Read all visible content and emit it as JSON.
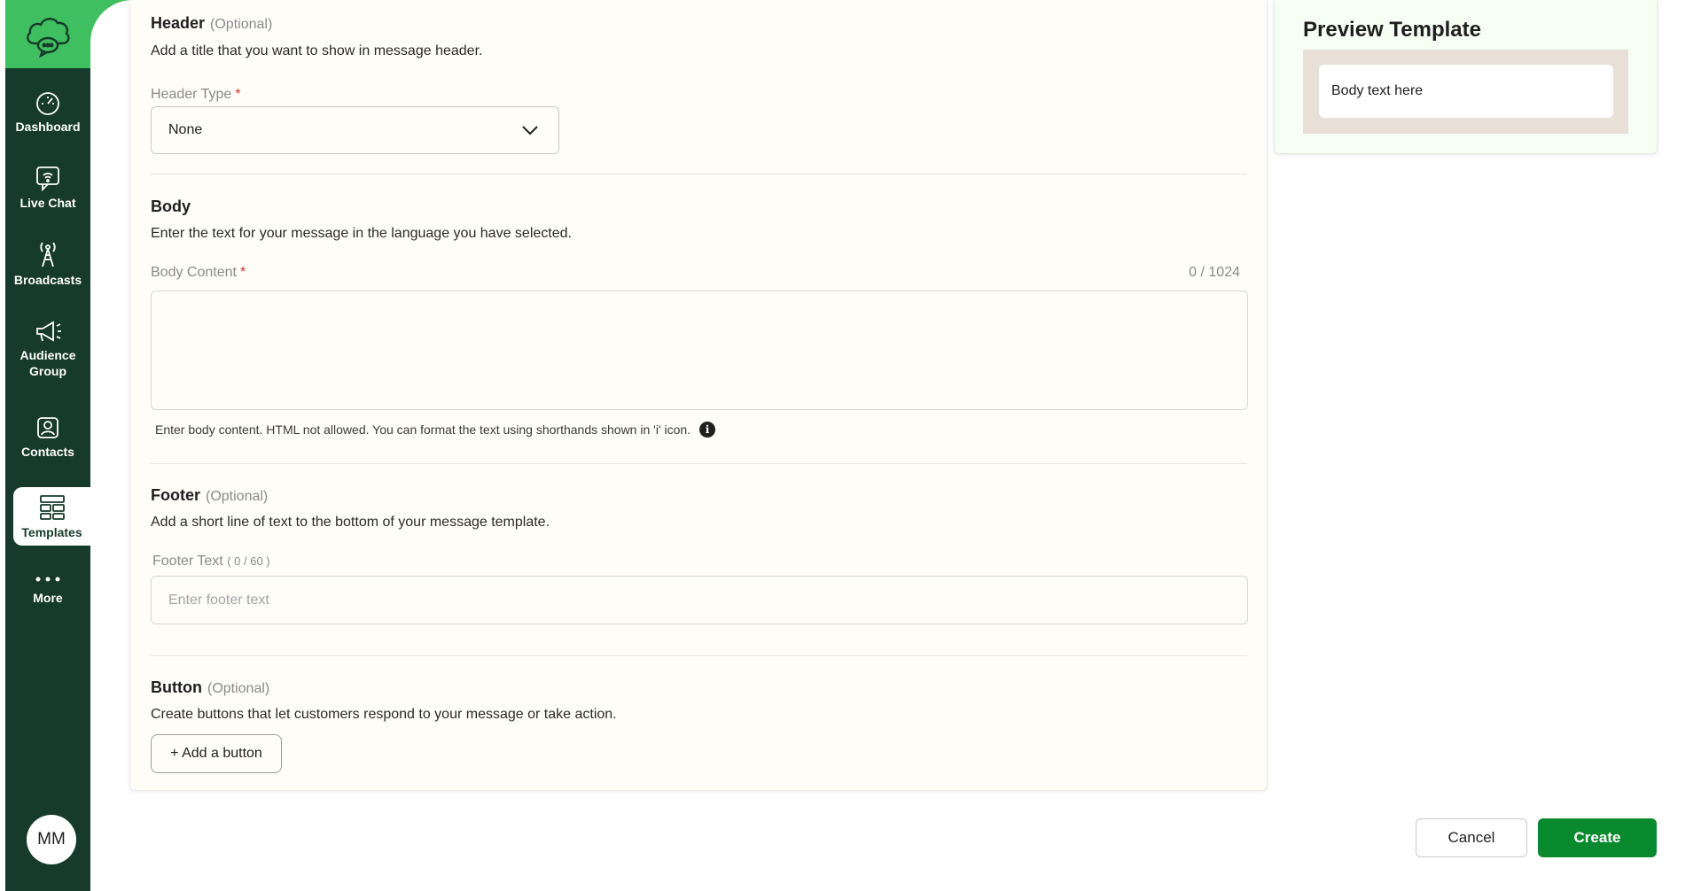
{
  "sidebar": {
    "logo": "cloud-chat-logo",
    "items": [
      {
        "label": "Dashboard",
        "icon": "dashboard-icon"
      },
      {
        "label": "Live Chat",
        "icon": "live-chat-icon"
      },
      {
        "label": "Broadcasts",
        "icon": "broadcast-icon"
      },
      {
        "label": "Audience Group",
        "icon": "megaphone-icon"
      },
      {
        "label": "Contacts",
        "icon": "contacts-icon"
      },
      {
        "label": "Templates",
        "icon": "templates-icon",
        "active": true
      },
      {
        "label": "More",
        "icon": "more-icon"
      }
    ],
    "avatar_initials": "MM"
  },
  "form": {
    "header": {
      "title": "Header",
      "optional": "(Optional)",
      "description": "Add a title that you want to show in message header.",
      "type_label": "Header Type",
      "required_mark": "*",
      "type_value": "None"
    },
    "body": {
      "title": "Body",
      "description": "Enter the text for your message in the language you have selected.",
      "content_label": "Body Content",
      "required_mark": "*",
      "counter": "0 / 1024",
      "hint": "Enter body content. HTML not allowed. You can format the text using shorthands shown in 'i' icon.",
      "info_glyph": "i"
    },
    "footer": {
      "title": "Footer",
      "optional": "(Optional)",
      "description": "Add a short line of text to the bottom of your message template.",
      "text_label": "Footer Text",
      "text_counter": "( 0 / 60 )",
      "placeholder": "Enter footer text"
    },
    "button": {
      "title": "Button",
      "optional": "(Optional)",
      "description": "Create buttons that let customers respond to your message or take action.",
      "add_label": "+ Add a button"
    }
  },
  "preview": {
    "title": "Preview Template",
    "body_text": "Body text here"
  },
  "actions": {
    "cancel_label": "Cancel",
    "create_label": "Create"
  },
  "colors": {
    "sidebar": "#163a2b",
    "accent_green": "#3fbf5f",
    "create_button": "#0a8a2e",
    "required": "#d0342c"
  }
}
